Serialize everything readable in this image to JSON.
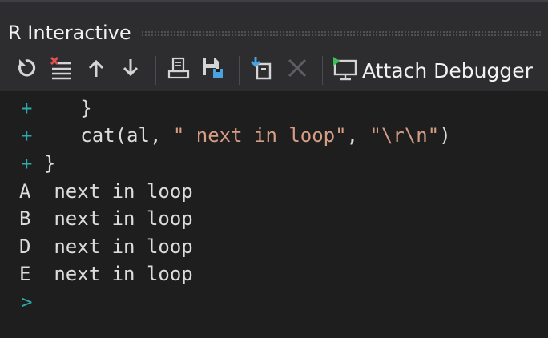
{
  "window": {
    "title": "R Interactive"
  },
  "toolbar": {
    "buttons": [
      {
        "name": "reset",
        "icon": "reset-icon"
      },
      {
        "name": "clear",
        "icon": "clear-icon"
      },
      {
        "name": "history-previous",
        "icon": "arrow-up-icon"
      },
      {
        "name": "history-next",
        "icon": "arrow-down-icon"
      },
      {
        "name": "load-workspace",
        "icon": "printer-icon"
      },
      {
        "name": "save-workspace",
        "icon": "save-icon"
      },
      {
        "name": "import-dataset",
        "icon": "import-icon"
      },
      {
        "name": "stop",
        "icon": "close-icon",
        "enabled": false
      }
    ],
    "attach_debugger_label": "Attach Debugger"
  },
  "console": {
    "lines": [
      {
        "prompt": "+",
        "code": "    }"
      },
      {
        "prompt": "+",
        "code_before": "    cat(al, ",
        "string1": "\" next in loop\"",
        "mid": ", ",
        "string2": "\"\\r\\n\"",
        "code_after": ")"
      },
      {
        "prompt": "+",
        "code": " }"
      },
      {
        "output": "A  next in loop"
      },
      {
        "output": "B  next in loop"
      },
      {
        "output": "D  next in loop"
      },
      {
        "output": "E  next in loop"
      }
    ],
    "input_prompt": ">"
  },
  "colors": {
    "background": "#1e1e1e",
    "chrome": "#2d2d30",
    "prompt": "#2fa9a9",
    "string": "#d69d85",
    "text": "#dcdcdc"
  }
}
